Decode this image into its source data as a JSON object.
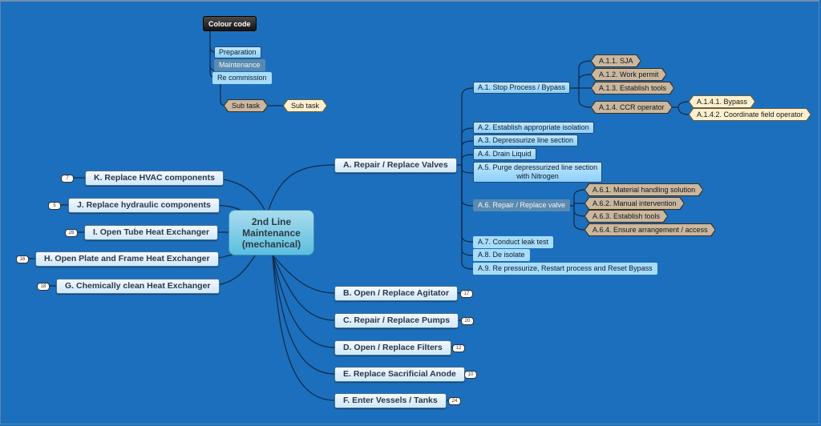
{
  "legend": {
    "title": "Colour code",
    "items": [
      "Preparation",
      "Maintenance",
      "Re commission"
    ],
    "subtask_a": "Sub task",
    "subtask_b": "Sub task"
  },
  "central": {
    "label": "2nd Line Maintenance (mechanical)"
  },
  "right_branches": [
    {
      "label": "A. Repair / Replace Valves",
      "count": ""
    },
    {
      "label": "B. Open / Replace Agitator",
      "count": "17"
    },
    {
      "label": "C. Repair / Replace Pumps",
      "count": "20"
    },
    {
      "label": "D. Open / Replace Filters",
      "count": "12"
    },
    {
      "label": "E. Replace Sacrificial Anode",
      "count": "10"
    },
    {
      "label": "F. Enter Vessels / Tanks",
      "count": "24"
    }
  ],
  "left_branches": [
    {
      "label": "K. Replace HVAC components",
      "count": "7"
    },
    {
      "label": "J. Replace hydraulic components",
      "count": "5"
    },
    {
      "label": "I. Open Tube Heat Exchanger",
      "count": "28"
    },
    {
      "label": "H. Open Plate and Frame Heat Exchanger",
      "count": "16"
    },
    {
      "label": "G. Chemically clean Heat Exchanger",
      "count": "18"
    }
  ],
  "valves": {
    "a1": "A.1. Stop Process / Bypass",
    "a1_children": [
      "A.1.1. SJA",
      "A.1.2. Work permit",
      "A.1.3. Establish tools",
      "A.1.4. CCR operator"
    ],
    "a14_children": [
      "A.1.4.1. Bypass",
      "A.1.4.2. Coordinate field operator"
    ],
    "a2": "A.2. Establish appropriate isolation",
    "a3": "A.3. Depressurize line section",
    "a4": "A.4. Drain Liquid",
    "a5_line1": "A.5. Purge depressurized line section",
    "a5_line2": "with Nitrogen",
    "a6": "A.6. Repair / Replace valve",
    "a6_children": [
      "A.6.1. Material handling solution",
      "A.6.2. Manual intervention",
      "A.6.3. Establish tools",
      "A.6.4. Ensure arrangement / access"
    ],
    "a7": "A.7. Conduct leak test",
    "a8": "A.8. De isolate",
    "a9": "A.9. Re pressurize, Restart process and Reset Bypass"
  }
}
